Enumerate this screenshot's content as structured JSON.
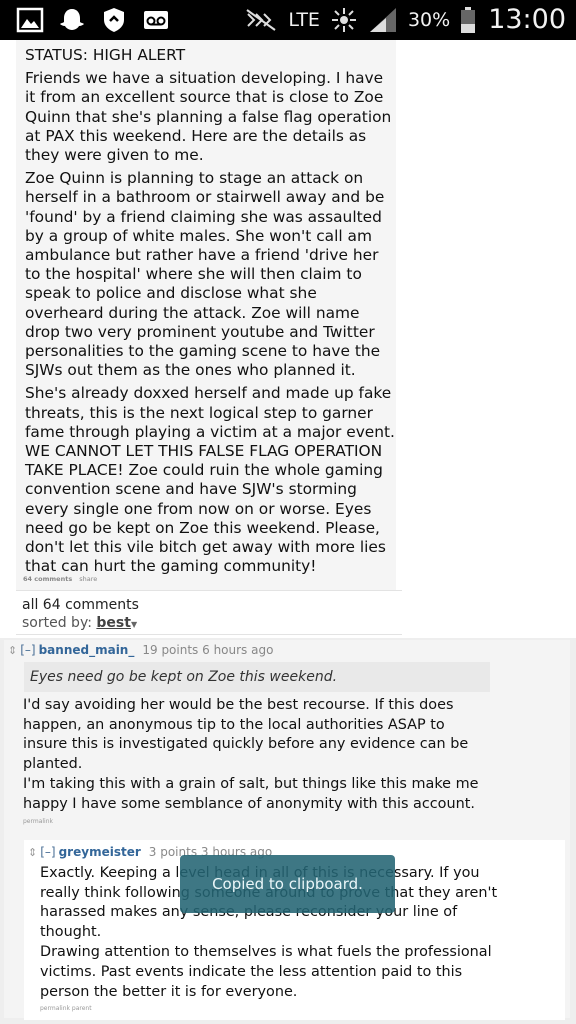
{
  "status_bar": {
    "icons_left": [
      "gallery-icon",
      "ghost-icon",
      "shield-icon",
      "voicemail-icon"
    ],
    "network": "LTE",
    "battery": "30%",
    "time": "13:00"
  },
  "post": {
    "paragraphs": [
      "STATUS: HIGH ALERT",
      "Friends we have a situation developing. I have it from an excellent source that is close to Zoe Quinn that she's planning a false flag operation at PAX this weekend. Here are the details as they were given to me.",
      "Zoe Quinn is planning to stage an attack on herself in a bathroom or stairwell away and be 'found' by a friend claiming she was assaulted by a group of white males. She won't call am ambulance but rather have a friend 'drive her to the hospital' where she will then claim to speak to police and disclose what she overheard during the attack. Zoe will name drop two very prominent youtube and Twitter personalities to the gaming scene to have the SJWs out them as the ones who planned it.",
      "She's already doxxed herself and made up fake threats, this is the next logical step to garner fame through playing a victim at a major event. WE CANNOT LET THIS FALSE FLAG OPERATION TAKE PLACE! Zoe could ruin the whole gaming convention scene and have SJW's storming every single one from now on or worse. Eyes need go be kept on Zoe this weekend. Please, don't let this vile bitch get away with more lies that can hurt the gaming community!"
    ],
    "comments_link": "64 comments",
    "share_link": "share"
  },
  "comments_header": {
    "title": "all 64 comments",
    "sorted_label": "sorted by:",
    "sorted_value": "best"
  },
  "comments": [
    {
      "collapse": "[–]",
      "author": "banned_main_",
      "meta": "19 points 6 hours ago",
      "quote": "Eyes need go be kept on Zoe this weekend.",
      "paragraphs": [
        "I'd say avoiding her would be the best recourse. If this does happen, an anonymous tip to the local authorities ASAP to insure this is investigated quickly before any evidence can be planted.",
        "I'm taking this with a grain of salt, but things like this make me happy I have some semblance of anonymity with this account."
      ],
      "links": "permalink"
    },
    {
      "collapse": "[–]",
      "author": "greymeister",
      "meta": "3 points 3 hours ago",
      "paragraphs": [
        "Exactly. Keeping a level head in all of this is necessary. If you really think following someone around to prove that they aren't harassed makes any sense, please reconsider your line of thought.",
        "Drawing attention to themselves is what fuels the professional victims. Past events indicate the less attention paid to this person the better it is for everyone."
      ],
      "links": "permalink  parent"
    }
  ],
  "toast": "Copied to clipboard."
}
